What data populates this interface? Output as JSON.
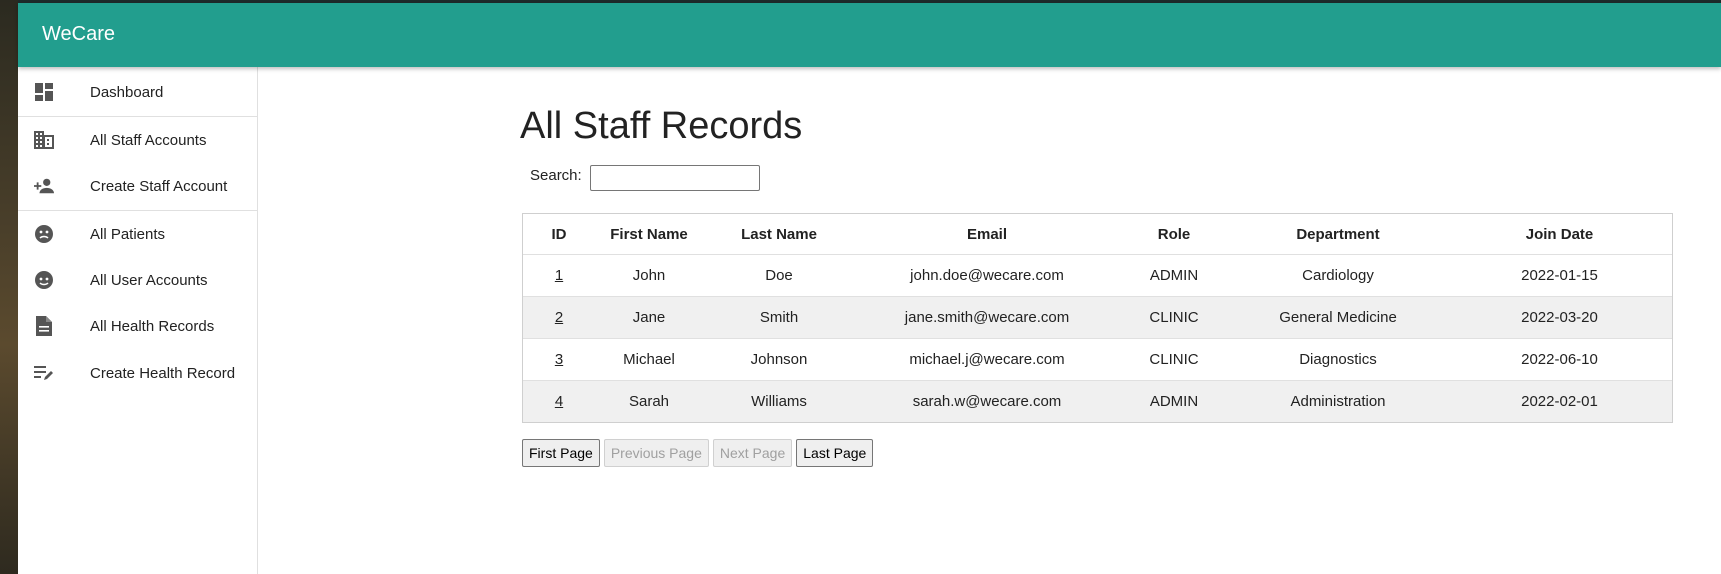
{
  "app": {
    "brand": "WeCare",
    "accent_color": "#229e8e"
  },
  "sidebar": {
    "items": [
      {
        "label": "Dashboard",
        "icon": "dashboard-icon"
      },
      {
        "label": "All Staff Accounts",
        "icon": "building-icon"
      },
      {
        "label": "Create Staff Account",
        "icon": "add-person-icon"
      },
      {
        "label": "All Patients",
        "icon": "sick-face-icon"
      },
      {
        "label": "All User Accounts",
        "icon": "face-icon"
      },
      {
        "label": "All Health Records",
        "icon": "document-icon"
      },
      {
        "label": "Create Health Record",
        "icon": "edit-note-icon"
      }
    ]
  },
  "main": {
    "title": "All Staff Records",
    "search": {
      "label": "Search:",
      "value": "",
      "placeholder": ""
    },
    "table": {
      "headers": [
        "ID",
        "First Name",
        "Last Name",
        "Email",
        "Role",
        "Department",
        "Join Date"
      ],
      "rows": [
        {
          "id": "1",
          "first_name": "John",
          "last_name": "Doe",
          "email": "john.doe@wecare.com",
          "role": "ADMIN",
          "department": "Cardiology",
          "join_date": "2022-01-15"
        },
        {
          "id": "2",
          "first_name": "Jane",
          "last_name": "Smith",
          "email": "jane.smith@wecare.com",
          "role": "CLINIC",
          "department": "General Medicine",
          "join_date": "2022-03-20"
        },
        {
          "id": "3",
          "first_name": "Michael",
          "last_name": "Johnson",
          "email": "michael.j@wecare.com",
          "role": "CLINIC",
          "department": "Diagnostics",
          "join_date": "2022-06-10"
        },
        {
          "id": "4",
          "first_name": "Sarah",
          "last_name": "Williams",
          "email": "sarah.w@wecare.com",
          "role": "ADMIN",
          "department": "Administration",
          "join_date": "2022-02-01"
        }
      ]
    },
    "pagination": {
      "first": "First Page",
      "previous": "Previous Page",
      "next": "Next Page",
      "last": "Last Page"
    }
  }
}
